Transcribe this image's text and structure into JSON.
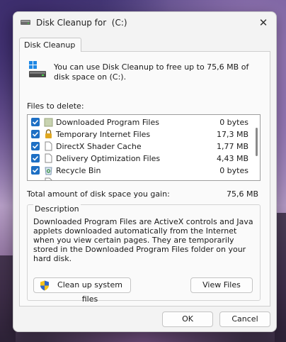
{
  "window": {
    "title": "Disk Cleanup for  (C:)",
    "close_glyph": "✕"
  },
  "tab": {
    "label": "Disk Cleanup"
  },
  "intro_text": "You can use Disk Cleanup to free up to 75,6 MB of disk space on  (C:).",
  "files_label": "Files to delete:",
  "files": [
    {
      "name": "Downloaded Program Files",
      "size": "0 bytes",
      "checked": true,
      "icon": "folder-icon"
    },
    {
      "name": "Temporary Internet Files",
      "size": "17,3 MB",
      "checked": true,
      "icon": "lock-icon"
    },
    {
      "name": "DirectX Shader Cache",
      "size": "1,77 MB",
      "checked": true,
      "icon": "document-icon"
    },
    {
      "name": "Delivery Optimization Files",
      "size": "4,43 MB",
      "checked": true,
      "icon": "document-icon"
    },
    {
      "name": "Recycle Bin",
      "size": "0 bytes",
      "checked": true,
      "icon": "recycle-bin-icon"
    }
  ],
  "total": {
    "label": "Total amount of disk space you gain:",
    "value": "75,6 MB"
  },
  "description": {
    "title": "Description",
    "text": "Downloaded Program Files are ActiveX controls and Java applets downloaded automatically from the Internet when you view certain pages. They are temporarily stored in the Downloaded Program Files folder on your hard disk."
  },
  "buttons": {
    "clean_system": "Clean up system files",
    "view_files": "View Files",
    "ok": "OK",
    "cancel": "Cancel"
  },
  "colors": {
    "accent": "#1d6fc4",
    "window_bg": "#f3f3f3"
  }
}
